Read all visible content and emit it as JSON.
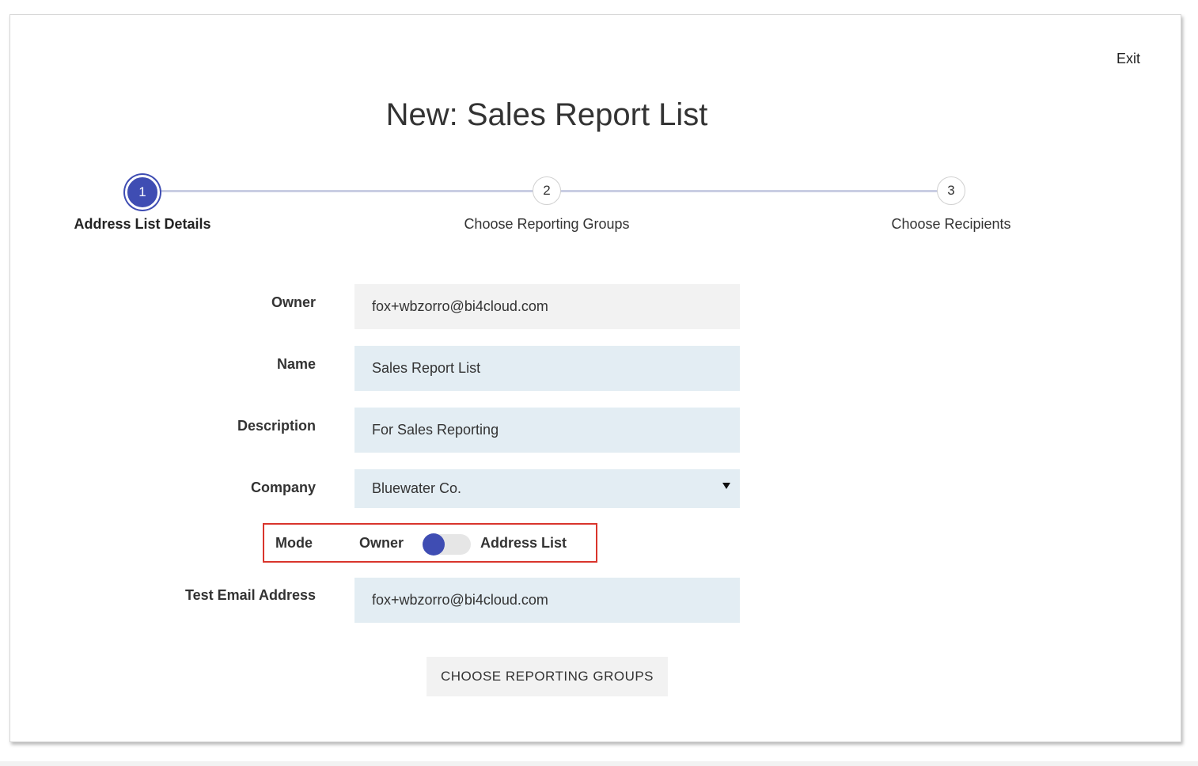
{
  "header": {
    "exit_label": "Exit",
    "title": "New: Sales Report List"
  },
  "stepper": {
    "steps": [
      {
        "number": "1",
        "label": "Address List Details",
        "active": true
      },
      {
        "number": "2",
        "label": "Choose Reporting Groups",
        "active": false
      },
      {
        "number": "3",
        "label": "Choose Recipients",
        "active": false
      }
    ]
  },
  "form": {
    "owner": {
      "label": "Owner",
      "value": "fox+wbzorro@bi4cloud.com"
    },
    "name": {
      "label": "Name",
      "value": "Sales Report List"
    },
    "description": {
      "label": "Description",
      "value": "For Sales Reporting"
    },
    "company": {
      "label": "Company",
      "value": "Bluewater Co."
    },
    "mode": {
      "label": "Mode",
      "option_left": "Owner",
      "option_right": "Address List",
      "selected": "Owner"
    },
    "test_email": {
      "label": "Test Email Address",
      "value": "fox+wbzorro@bi4cloud.com"
    }
  },
  "actions": {
    "next_label": "CHOOSE REPORTING GROUPS"
  },
  "colors": {
    "accent": "#3f4db3",
    "highlight_border": "#d9352c",
    "editable_field": "#e3edf3",
    "readonly_field": "#f2f2f2"
  }
}
